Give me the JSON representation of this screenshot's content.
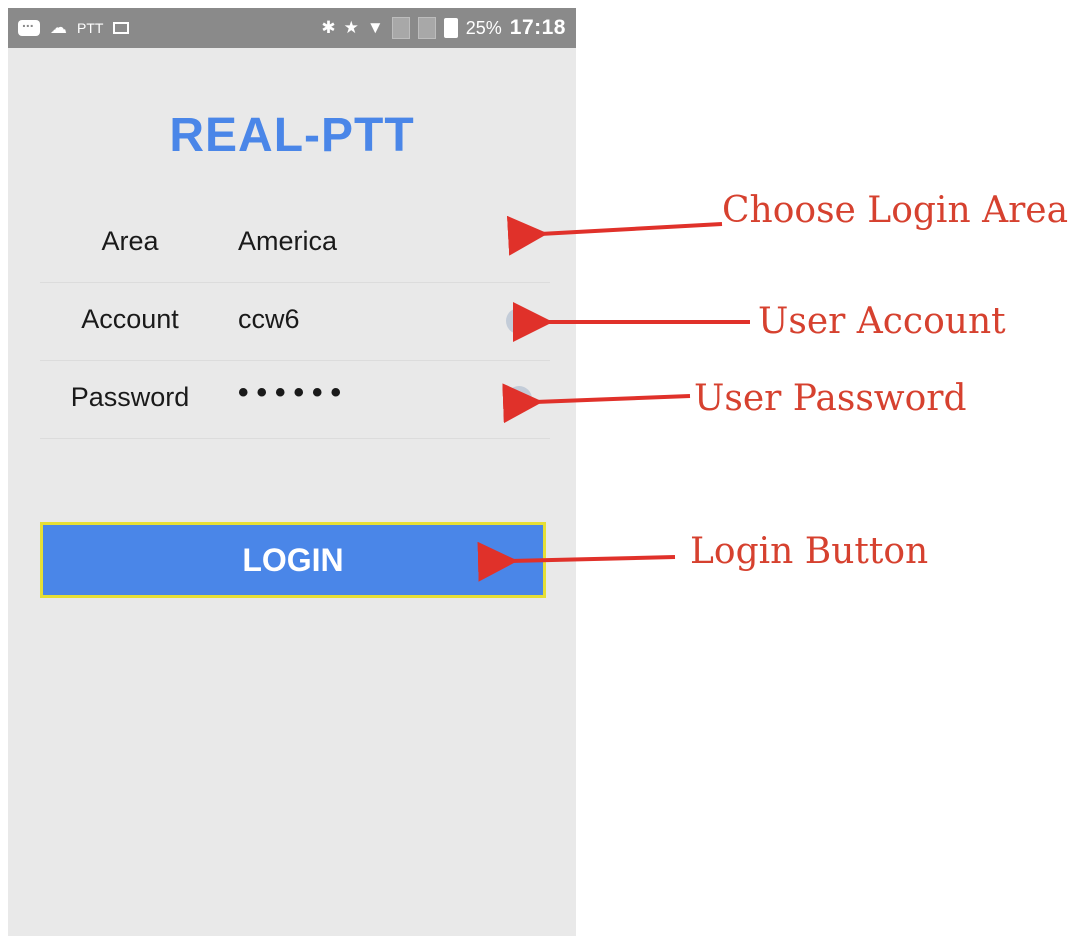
{
  "status_bar": {
    "ptt_label": "PTT",
    "battery_pct": "25%",
    "time": "17:18"
  },
  "app": {
    "title": "REAL-PTT"
  },
  "form": {
    "area": {
      "label": "Area",
      "value": "America"
    },
    "account": {
      "label": "Account",
      "value": "ccw6"
    },
    "password": {
      "label": "Password",
      "value": "••••••"
    }
  },
  "login_button": {
    "label": "LOGIN"
  },
  "annotations": {
    "area": "Choose Login Area",
    "account": "User Account",
    "password": "User Password",
    "login": "Login Button"
  },
  "icons": {
    "status": [
      "message-icon",
      "cloud-icon",
      "image-icon",
      "bluetooth-icon",
      "star-icon",
      "wifi-icon",
      "no-sim-icon",
      "battery-icon"
    ],
    "clear": "clear-circle-icon",
    "dropdown": "chevron-down-icon"
  },
  "colors": {
    "title": "#4a86e8",
    "button_bg": "#4a86e8",
    "button_border": "#e6df35",
    "annotation": "#d6412f",
    "background": "#e9e9e9"
  }
}
